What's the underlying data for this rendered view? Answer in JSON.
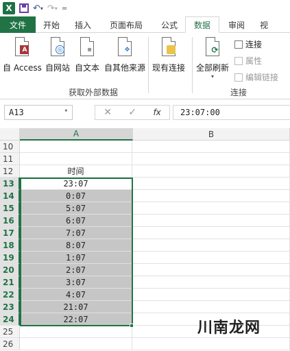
{
  "qat": {
    "app_icon": "X",
    "undo_glyph": "↶",
    "redo_glyph": "↷",
    "more_glyph": "=",
    "drop_glyph": "▾"
  },
  "tabs": [
    "文件",
    "开始",
    "插入",
    "页面布局",
    "公式",
    "数据",
    "审阅",
    "视"
  ],
  "active_tab": "数据",
  "ribbon": {
    "get_external": {
      "buttons": [
        "自 Access",
        "自网站",
        "自文本",
        "自其他来源"
      ],
      "label": "获取外部数据"
    },
    "existing_conn": "现有连接",
    "refresh_all": "全部刷新",
    "connections": {
      "items": [
        "连接",
        "属性",
        "编辑链接"
      ],
      "label": "连接"
    }
  },
  "formula_bar": {
    "name_box": "A13",
    "cancel": "✕",
    "enter": "✓",
    "fx": "fx",
    "value": "23:07:00"
  },
  "grid": {
    "columns": [
      "A",
      "B"
    ],
    "rows": [
      {
        "num": "10",
        "a": ""
      },
      {
        "num": "11",
        "a": ""
      },
      {
        "num": "12",
        "a": "时间"
      },
      {
        "num": "13",
        "a": "23:07"
      },
      {
        "num": "14",
        "a": "0:07"
      },
      {
        "num": "15",
        "a": "5:07"
      },
      {
        "num": "16",
        "a": "6:07"
      },
      {
        "num": "17",
        "a": "7:07"
      },
      {
        "num": "18",
        "a": "8:07"
      },
      {
        "num": "19",
        "a": "1:07"
      },
      {
        "num": "20",
        "a": "2:07"
      },
      {
        "num": "21",
        "a": "3:07"
      },
      {
        "num": "22",
        "a": "4:07"
      },
      {
        "num": "23",
        "a": "21:07"
      },
      {
        "num": "24",
        "a": "22:07"
      },
      {
        "num": "25",
        "a": ""
      },
      {
        "num": "26",
        "a": ""
      }
    ],
    "selection_start_row": "13",
    "selection_end_row": "24"
  },
  "watermark": "川南龙网",
  "colors": {
    "accent": "#217346",
    "selection": "#c6c6c6"
  }
}
